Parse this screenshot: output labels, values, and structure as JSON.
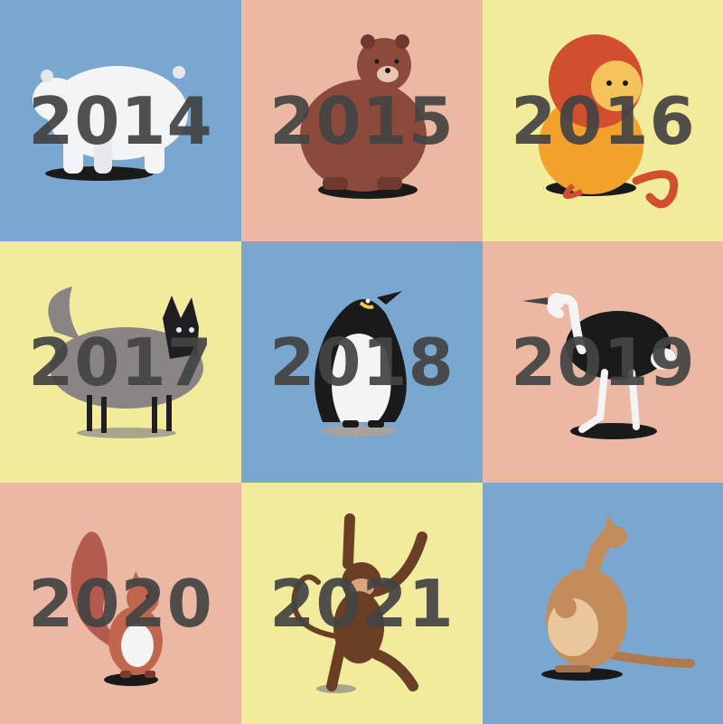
{
  "colors": {
    "blue": "#7aa7d0",
    "pink": "#eab8a3",
    "yellow": "#f2eb9c",
    "text": "#444444"
  },
  "tiles": [
    {
      "year": "2014",
      "animal": "polar-bear",
      "background": "blue"
    },
    {
      "year": "2015",
      "animal": "brown-bear",
      "background": "pink"
    },
    {
      "year": "2016",
      "animal": "lion",
      "background": "yellow"
    },
    {
      "year": "2017",
      "animal": "wolf",
      "background": "yellow"
    },
    {
      "year": "2018",
      "animal": "penguin",
      "background": "blue"
    },
    {
      "year": "2019",
      "animal": "ostrich",
      "background": "pink"
    },
    {
      "year": "2020",
      "animal": "squirrel",
      "background": "pink"
    },
    {
      "year": "2021",
      "animal": "monkey",
      "background": "yellow"
    },
    {
      "year": "",
      "animal": "kangaroo",
      "background": "blue"
    }
  ]
}
